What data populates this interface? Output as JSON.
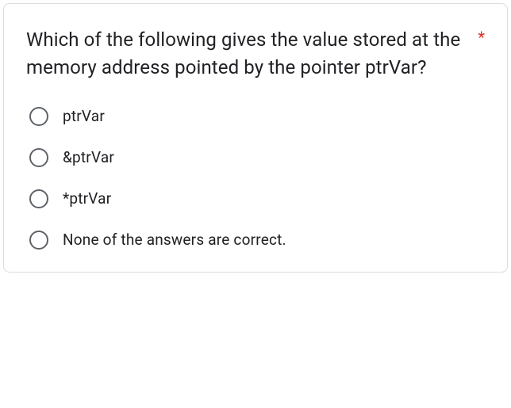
{
  "question": {
    "text": "Which of the following gives the value stored at the memory address pointed by the pointer ptrVar?",
    "required_marker": "*"
  },
  "options": [
    {
      "label": "ptrVar"
    },
    {
      "label": "&ptrVar"
    },
    {
      "label": "*ptrVar"
    },
    {
      "label": "None of the answers are correct."
    }
  ]
}
